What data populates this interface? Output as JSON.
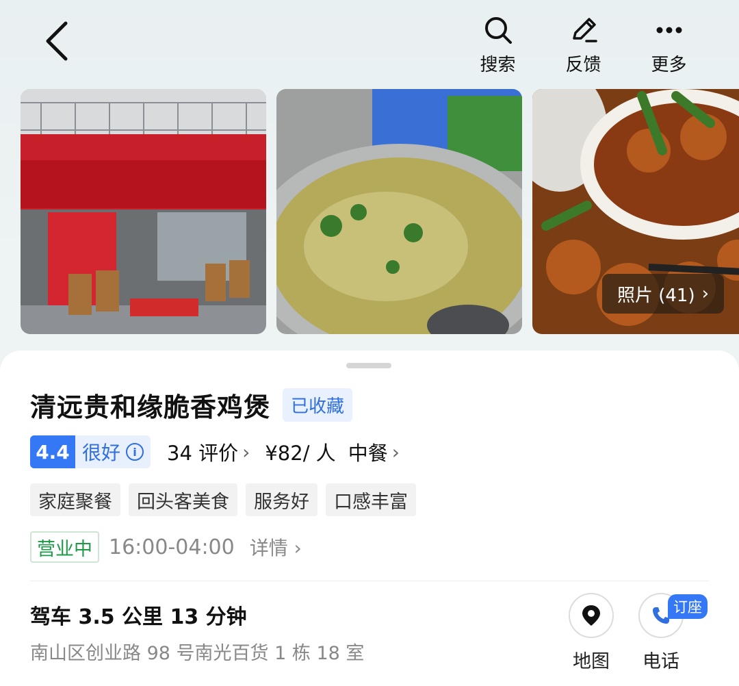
{
  "header": {
    "actions": [
      {
        "label": "搜索",
        "icon": "search-icon"
      },
      {
        "label": "反馈",
        "icon": "pencil-icon"
      },
      {
        "label": "更多",
        "icon": "more-dots-icon"
      }
    ]
  },
  "photos": {
    "count_label": "照片 (41)"
  },
  "restaurant": {
    "name": "清远贵和缘脆香鸡煲",
    "favorite_badge": "已收藏",
    "rating_score": "4.4",
    "rating_text": "很好",
    "reviews": "34 评价",
    "price": "¥82/ 人",
    "cuisine": "中餐",
    "tags": [
      "家庭聚餐",
      "回头客美食",
      "服务好",
      "口感丰富"
    ],
    "status": "营业中",
    "hours": "16:00-04:00",
    "details_label": "详情",
    "route": "驾车 3.5 公里 13 分钟",
    "address": "南山区创业路 98 号南光百货 1 栋 18 室"
  },
  "actions": {
    "map_label": "地图",
    "phone_label": "电话",
    "reserve_badge": "订座"
  },
  "colors": {
    "accent_blue": "#3478f6",
    "open_green": "#1e9a47"
  }
}
